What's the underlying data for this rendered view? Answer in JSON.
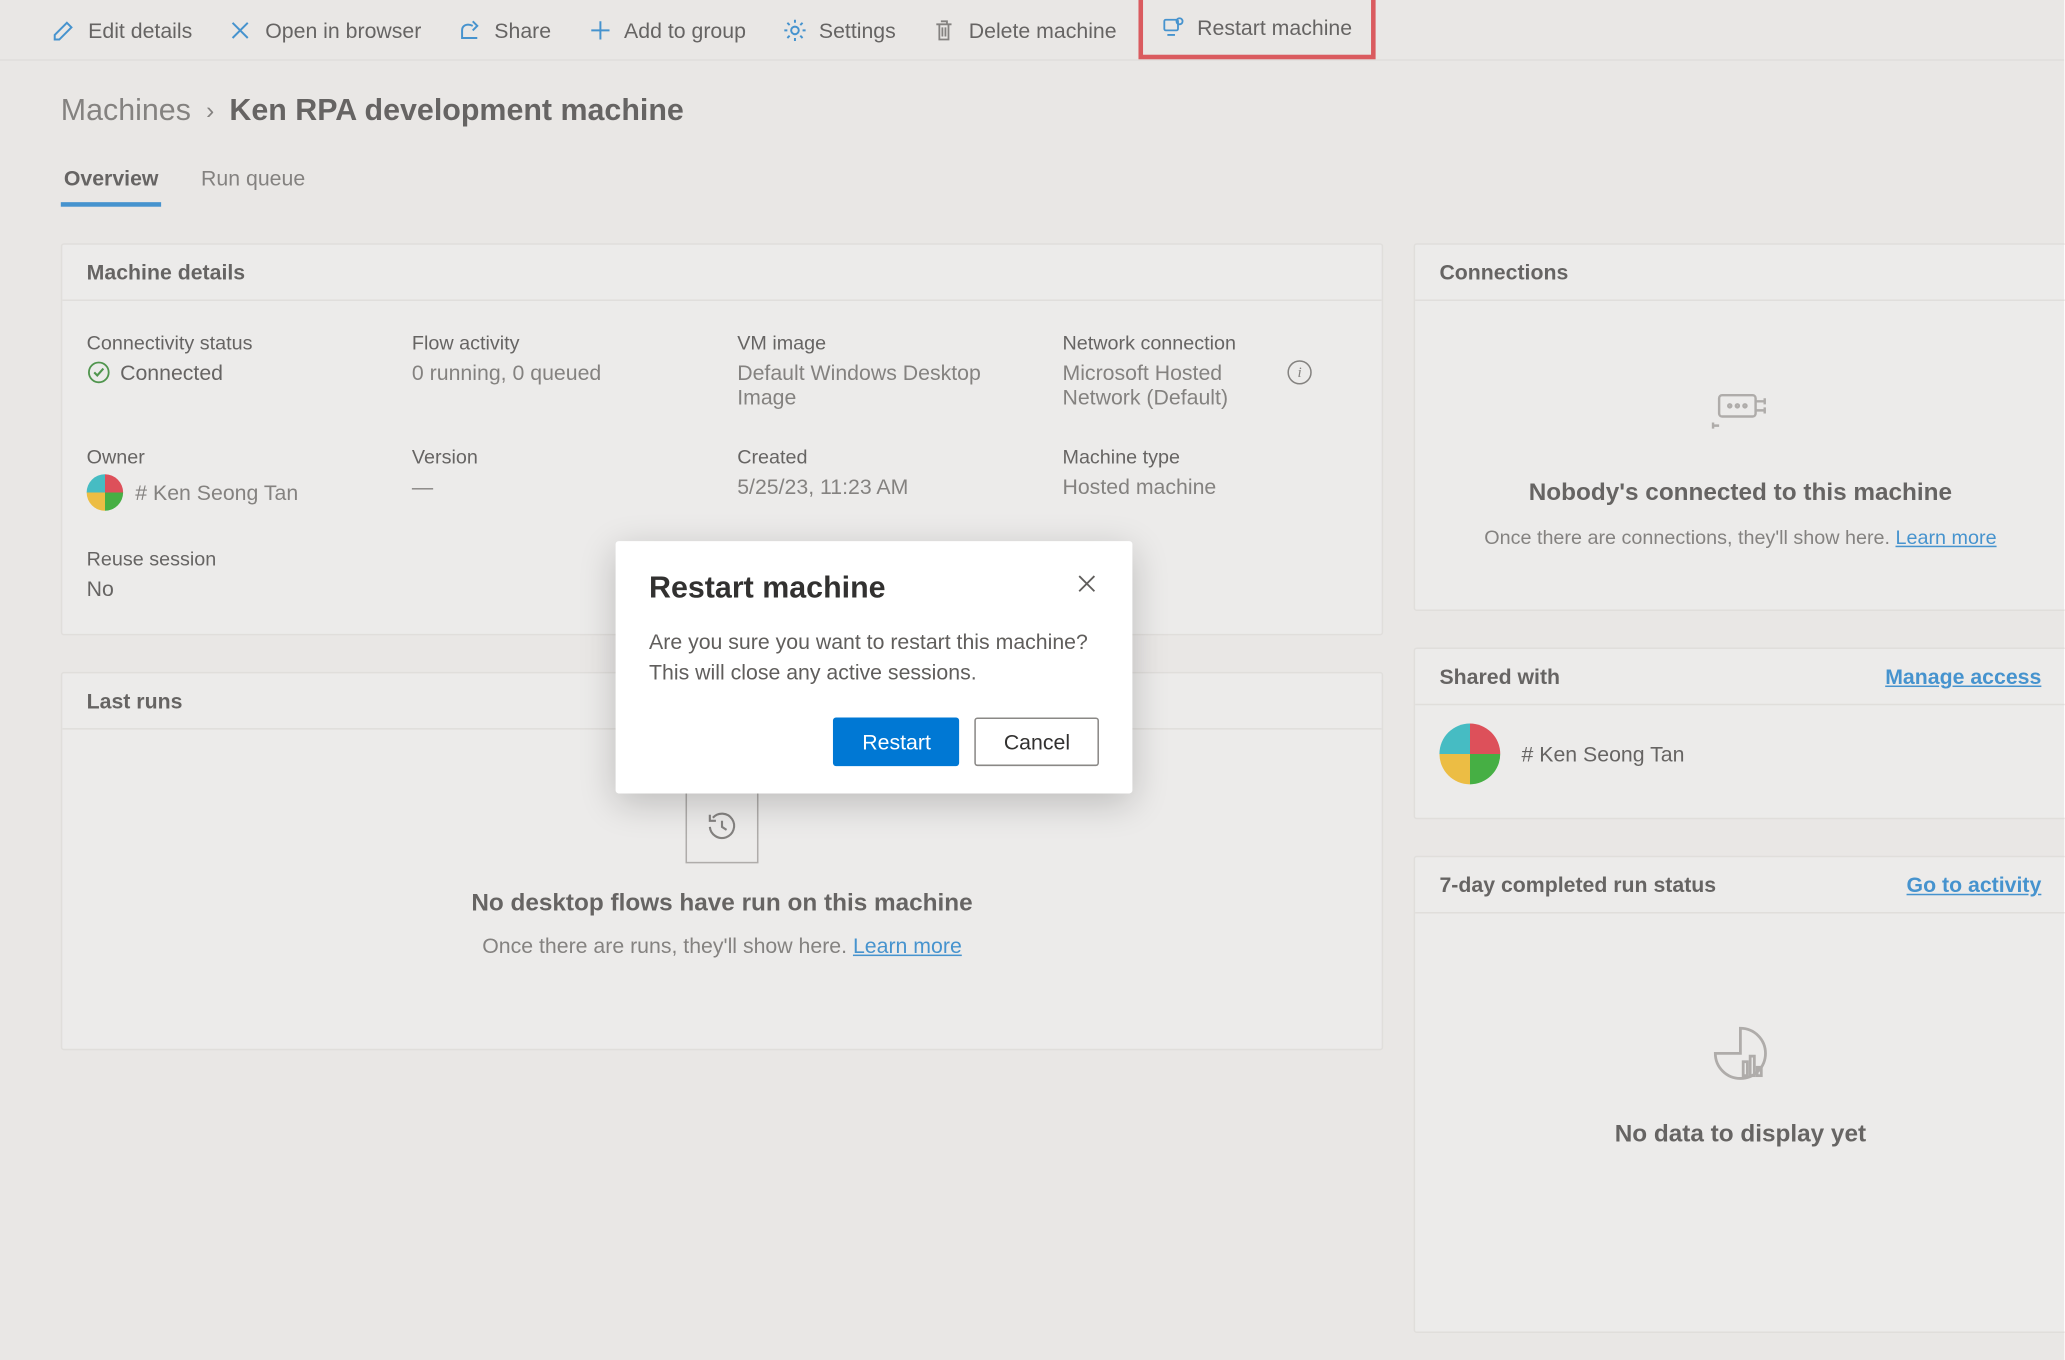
{
  "toolbar": {
    "edit": "Edit details",
    "open": "Open in browser",
    "share": "Share",
    "add": "Add to group",
    "settings": "Settings",
    "delete": "Delete machine",
    "restart": "Restart machine"
  },
  "breadcrumb": {
    "root": "Machines",
    "current": "Ken RPA development machine"
  },
  "tabs": {
    "overview": "Overview",
    "runqueue": "Run queue"
  },
  "details": {
    "card_title": "Machine details",
    "labels": {
      "connectivity": "Connectivity status",
      "flow": "Flow activity",
      "vm": "VM image",
      "net": "Network connection",
      "owner": "Owner",
      "version": "Version",
      "created": "Created",
      "mtype": "Machine type",
      "reuse": "Reuse session"
    },
    "values": {
      "connectivity": "Connected",
      "flow": "0 running, 0 queued",
      "vm": "Default Windows Desktop Image",
      "net": "Microsoft Hosted Network (Default)",
      "owner": "# Ken Seong Tan",
      "version": "—",
      "created": "5/25/23, 11:23 AM",
      "mtype": "Hosted machine",
      "reuse": "No"
    }
  },
  "lastruns": {
    "title": "Last runs",
    "empty_title": "No desktop flows have run on this machine",
    "empty_sub": "Once there are runs, they'll show here. ",
    "learn": "Learn more"
  },
  "connections": {
    "title": "Connections",
    "empty_title": "Nobody's connected to this machine",
    "empty_sub": "Once there are connections, they'll show here. ",
    "learn": "Learn more"
  },
  "shared": {
    "title": "Shared with",
    "manage": "Manage access",
    "user": "# Ken Seong Tan"
  },
  "runstatus": {
    "title": "7-day completed run status",
    "link": "Go to activity",
    "empty": "No data to display yet"
  },
  "dialog": {
    "title": "Restart machine",
    "message": "Are you sure you want to restart this machine? This will close any active sessions.",
    "restart": "Restart",
    "cancel": "Cancel"
  }
}
